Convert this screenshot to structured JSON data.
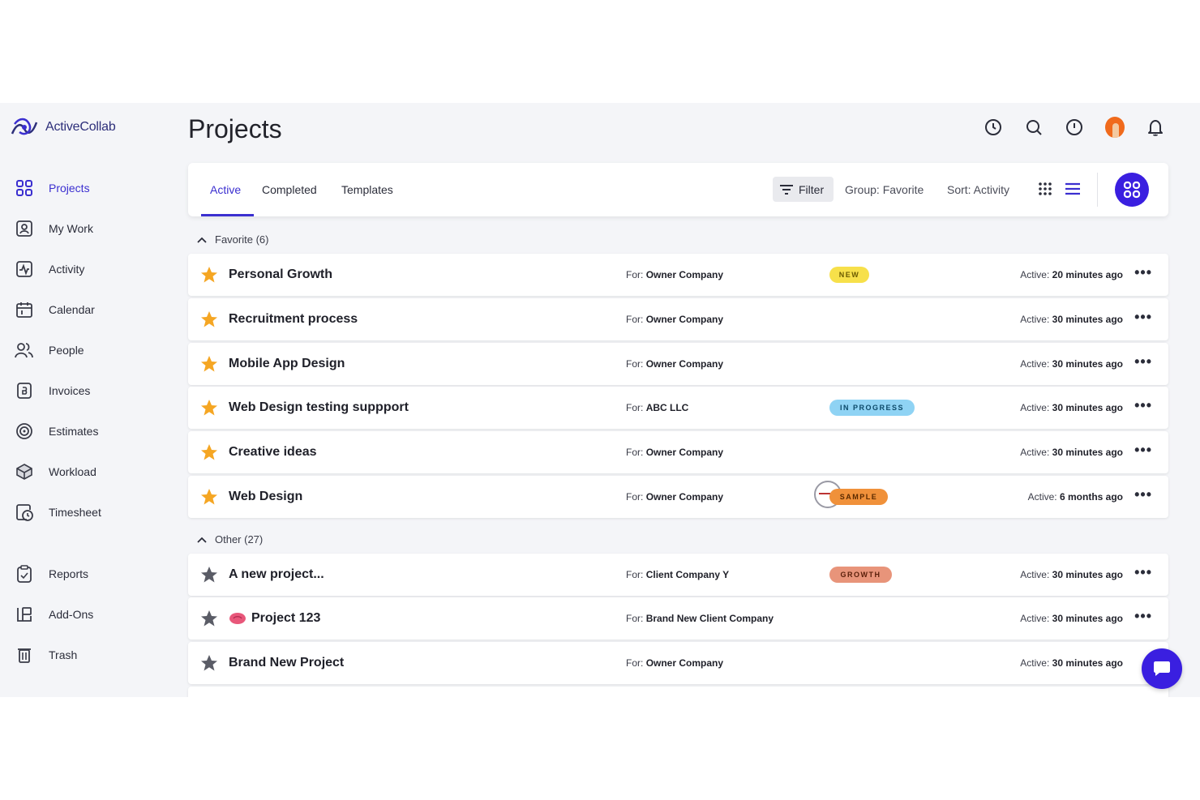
{
  "app": {
    "name": "ActiveCollab",
    "accent": "#3b2fd0"
  },
  "sidebar": {
    "items": [
      {
        "label": "Projects",
        "icon": "grid-icon",
        "active": true
      },
      {
        "label": "My Work",
        "icon": "user-card-icon"
      },
      {
        "label": "Activity",
        "icon": "activity-icon"
      },
      {
        "label": "Calendar",
        "icon": "calendar-icon"
      },
      {
        "label": "People",
        "icon": "people-icon"
      },
      {
        "label": "Invoices",
        "icon": "invoice-icon"
      },
      {
        "label": "Estimates",
        "icon": "estimate-icon"
      },
      {
        "label": "Workload",
        "icon": "workload-icon"
      },
      {
        "label": "Timesheet",
        "icon": "timesheet-icon"
      },
      {
        "label": "Reports",
        "icon": "reports-icon"
      },
      {
        "label": "Add-Ons",
        "icon": "addons-icon"
      },
      {
        "label": "Trash",
        "icon": "trash-icon"
      }
    ]
  },
  "header": {
    "title": "Projects"
  },
  "toolbar": {
    "tabs": [
      "Active",
      "Completed",
      "Templates"
    ],
    "filter_label": "Filter",
    "group_label": "Group: Favorite",
    "sort_label": "Sort: Activity"
  },
  "groups": {
    "favorite": {
      "label": "Favorite (6)",
      "rows": [
        {
          "name": "Personal Growth",
          "client_prefix": "For:",
          "client": "Owner Company",
          "badge": "NEW",
          "activity_prefix": "Active:",
          "activity": "20 minutes ago"
        },
        {
          "name": "Recruitment process",
          "client_prefix": "For:",
          "client": "Owner Company",
          "badge": "",
          "activity_prefix": "Active:",
          "activity": "30 minutes ago"
        },
        {
          "name": "Mobile App Design",
          "client_prefix": "For:",
          "client": "Owner Company",
          "badge": "",
          "activity_prefix": "Active:",
          "activity": "30 minutes ago"
        },
        {
          "name": "Web Design testing suppport",
          "client_prefix": "For:",
          "client": "ABC LLC",
          "badge": "IN PROGRESS",
          "activity_prefix": "Active:",
          "activity": "30 minutes ago"
        },
        {
          "name": "Creative ideas",
          "client_prefix": "For:",
          "client": "Owner Company",
          "badge": "",
          "activity_prefix": "Active:",
          "activity": "30 minutes ago"
        },
        {
          "name": "Web Design",
          "client_prefix": "For:",
          "client": "Owner Company",
          "badge": "SAMPLE",
          "activity_prefix": "Active:",
          "activity": "6 months ago"
        }
      ]
    },
    "other": {
      "label": "Other (27)",
      "rows": [
        {
          "name": "A new project...",
          "client_prefix": "For:",
          "client": "Client Company Y",
          "badge": "GROWTH",
          "activity_prefix": "Active:",
          "activity": "30 minutes ago"
        },
        {
          "name": "Project 123",
          "client_prefix": "For:",
          "client": "Brand New Client Company",
          "badge": "",
          "activity_prefix": "Active:",
          "activity": "30 minutes ago"
        },
        {
          "name": "Brand New Project",
          "client_prefix": "For:",
          "client": "Owner Company",
          "badge": "",
          "activity_prefix": "Active:",
          "activity": "30 minutes ago"
        }
      ]
    }
  },
  "colors": {
    "star_favorite": "#f5a623",
    "star_other": "#5a5c66",
    "badge_new": "#f7e04a",
    "badge_in_progress": "#8fd3f4",
    "badge_sample": "#f0913a",
    "badge_growth": "#e8947a"
  }
}
